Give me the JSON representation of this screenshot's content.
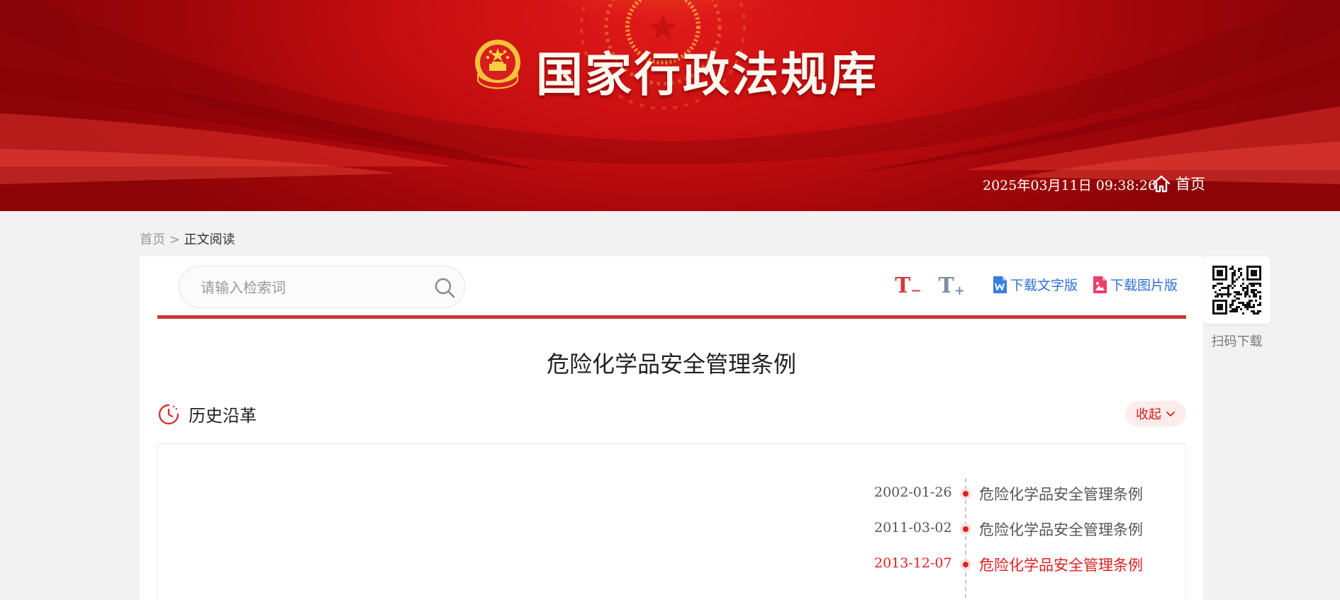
{
  "header": {
    "site_title": "国家行政法规库",
    "datetime": "2025年03月11日 09:38:26",
    "home_label": "首页"
  },
  "breadcrumb": {
    "home": "首页",
    "separator": " > ",
    "current": "正文阅读"
  },
  "search": {
    "placeholder": "请输入检索词",
    "value": ""
  },
  "toolbar": {
    "font_decrease": "T",
    "font_decrease_sign": "−",
    "font_increase": "T",
    "font_increase_sign": "+",
    "download_text": "下载文字版",
    "download_image": "下载图片版"
  },
  "document": {
    "title": "危险化学品安全管理条例"
  },
  "history": {
    "title": "历史沿革",
    "collapse_label": "收起",
    "entries": [
      {
        "date": "2002-01-26",
        "name": "危险化学品安全管理条例",
        "active": false
      },
      {
        "date": "2011-03-02",
        "name": "危险化学品安全管理条例",
        "active": false
      },
      {
        "date": "2013-12-07",
        "name": "危险化学品安全管理条例",
        "active": true
      }
    ]
  },
  "qr": {
    "label": "扫码下载"
  },
  "colors": {
    "header_red": "#c40d10",
    "accent_red": "#c8392f",
    "active_red": "#e01f1f",
    "link_blue": "#2f6fd4"
  },
  "icons": {
    "emblem": "national-emblem-icon",
    "home": "home-icon",
    "search": "search-icon",
    "word": "word-doc-icon",
    "image": "image-doc-icon",
    "history": "history-clock-icon",
    "chevron": "chevron-down-icon",
    "qr": "qr-code-icon"
  }
}
